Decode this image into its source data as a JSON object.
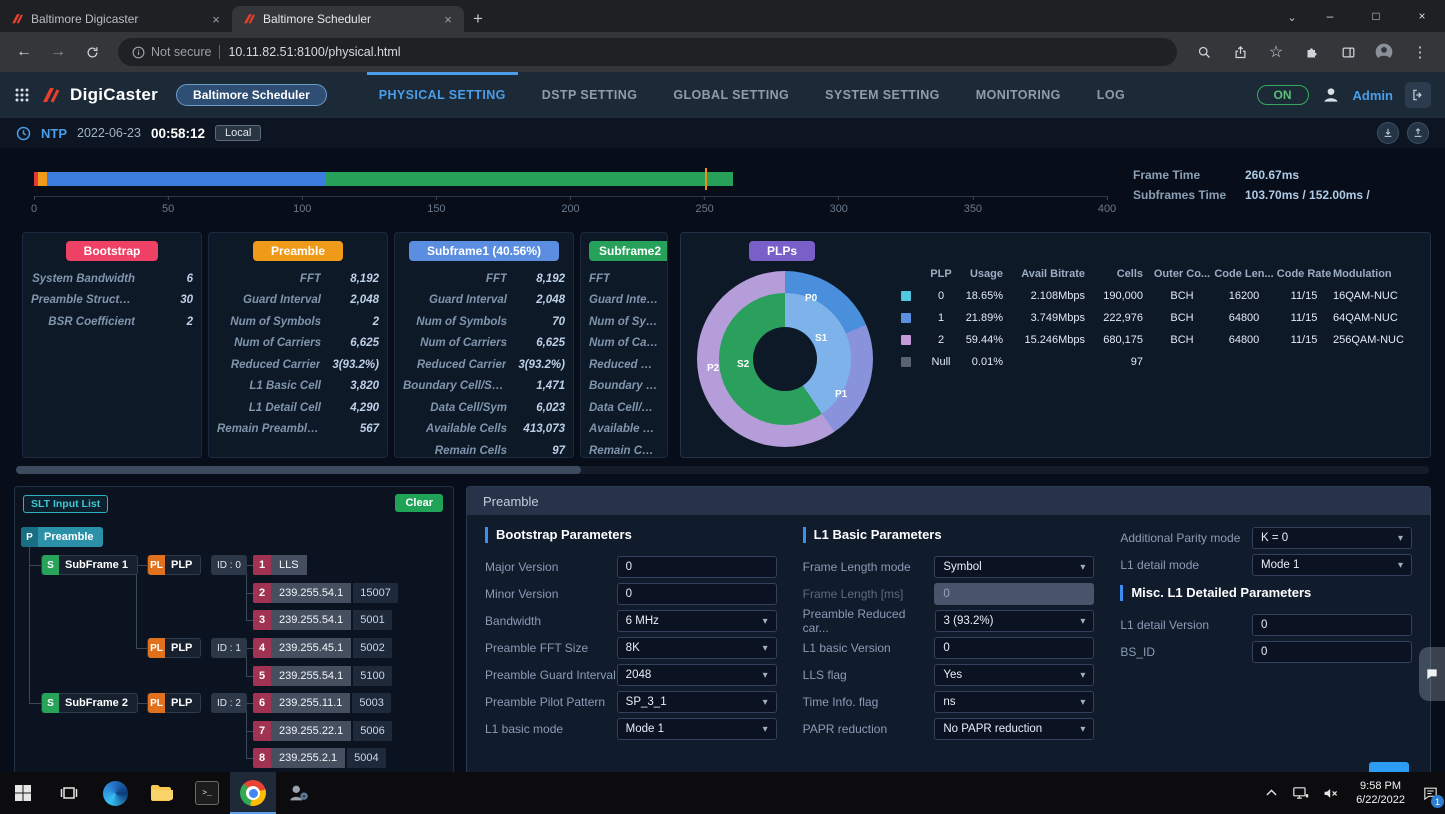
{
  "browser": {
    "tab1": "Baltimore Digicaster",
    "tab2": "Baltimore Scheduler",
    "security": "Not secure",
    "url": "10.11.82.51:8100/physical.html"
  },
  "app_header": {
    "logo_text": "DigiCaster",
    "site": "Baltimore Scheduler",
    "nav": [
      "PHYSICAL SETTING",
      "DSTP SETTING",
      "GLOBAL SETTING",
      "SYSTEM SETTING",
      "MONITORING",
      "LOG"
    ],
    "power": "ON",
    "user": "Admin",
    "accent_color": "#4a9de8"
  },
  "ntp": {
    "label": "NTP",
    "date": "2022-06-23",
    "time": "00:58:12",
    "mode": "Local"
  },
  "timeline": {
    "axis_max": 400,
    "ticks": [
      "0",
      "50",
      "100",
      "150",
      "200",
      "250",
      "300",
      "350",
      "400"
    ],
    "segments": [
      {
        "color": "#e03a3a",
        "start": 0,
        "end": 1.5
      },
      {
        "color": "#f09a1a",
        "start": 1.5,
        "end": 4.8
      },
      {
        "color": "#3d7de0",
        "start": 4.8,
        "end": 108.5
      },
      {
        "color": "#27a05a",
        "start": 108.5,
        "end": 260.67
      }
    ],
    "marker": 250,
    "frame_time_label": "Frame Time",
    "frame_time": "260.67ms",
    "subframes_label": "Subframes Time",
    "subframes": "103.70ms / 152.00ms /"
  },
  "cards": [
    {
      "title": "Bootstrap",
      "color": "#ee4165",
      "rows": [
        {
          "l": "System Bandwidth",
          "v": "6"
        },
        {
          "l": "Preamble Structure",
          "v": "30"
        },
        {
          "l": "BSR Coefficient",
          "v": "2"
        }
      ]
    },
    {
      "title": "Preamble",
      "color": "#f09a1a",
      "rows": [
        {
          "l": "FFT",
          "v": "8,192"
        },
        {
          "l": "Guard Interval",
          "v": "2,048"
        },
        {
          "l": "Num of Symbols",
          "v": "2"
        },
        {
          "l": "Num of Carriers",
          "v": "6,625"
        },
        {
          "l": "Reduced Carrier",
          "v": "3(93.2%)"
        },
        {
          "l": "L1 Basic Cell",
          "v": "3,820"
        },
        {
          "l": "L1 Detail Cell",
          "v": "4,290"
        },
        {
          "l": "Remain Preamble ...",
          "v": "567"
        }
      ]
    },
    {
      "title": "Subframe1 (40.56%)",
      "color": "#5b8de0",
      "rows": [
        {
          "l": "FFT",
          "v": "8,192"
        },
        {
          "l": "Guard Interval",
          "v": "2,048"
        },
        {
          "l": "Num of Symbols",
          "v": "70"
        },
        {
          "l": "Num of Carriers",
          "v": "6,625"
        },
        {
          "l": "Reduced Carrier",
          "v": "3(93.2%)"
        },
        {
          "l": "Boundary Cell/Sym",
          "v": "1,471"
        },
        {
          "l": "Data Cell/Sym",
          "v": "6,023"
        },
        {
          "l": "Available Cells",
          "v": "413,073"
        },
        {
          "l": "Remain Cells",
          "v": "97"
        }
      ]
    },
    {
      "title": "Subframe2",
      "color": "#27a05a",
      "rows": [
        {
          "l": "FFT",
          "v": ""
        },
        {
          "l": "Guard Interval",
          "v": ""
        },
        {
          "l": "Num of Symbols",
          "v": ""
        },
        {
          "l": "Num of Carriers",
          "v": ""
        },
        {
          "l": "Reduced Carrier",
          "v": ""
        },
        {
          "l": "Boundary Cell/Sym",
          "v": ""
        },
        {
          "l": "Data Cell/Sym",
          "v": ""
        },
        {
          "l": "Available Cells",
          "v": ""
        },
        {
          "l": "Remain Cells",
          "v": ""
        }
      ]
    }
  ],
  "plps": {
    "title": "PLPs",
    "badge_color": "#7a5fc8",
    "chart": {
      "type": "donut",
      "outer": [
        {
          "label": "P0",
          "value": 18.65,
          "color": "#4a8fdb"
        },
        {
          "label": "P1",
          "value": 21.89,
          "color": "#8893dc"
        },
        {
          "label": "P2",
          "value": 59.46,
          "color": "#b49dd8"
        }
      ],
      "inner": [
        {
          "label": "S1",
          "value": 40.56,
          "color": "#7db3ea"
        },
        {
          "label": "S2",
          "value": 59.44,
          "color": "#2aa05c"
        }
      ]
    },
    "table": {
      "headers": [
        "PLP",
        "Usage",
        "Avail Bitrate",
        "Cells",
        "Outer Co...",
        "Code Len...",
        "Code Rate",
        "Modulation"
      ],
      "rows": [
        {
          "color": "#52c8e0",
          "cells": [
            "0",
            "18.65%",
            "2.108Mbps",
            "190,000",
            "BCH",
            "16200",
            "11/15",
            "16QAM-NUC"
          ]
        },
        {
          "color": "#5b8fe0",
          "cells": [
            "1",
            "21.89%",
            "3.749Mbps",
            "222,976",
            "BCH",
            "64800",
            "11/15",
            "64QAM-NUC"
          ]
        },
        {
          "color": "#c49bd6",
          "cells": [
            "2",
            "59.44%",
            "15.246Mbps",
            "680,175",
            "BCH",
            "64800",
            "11/15",
            "256QAM-NUC"
          ]
        },
        {
          "color": "#596273",
          "cells": [
            "Null",
            "0.01%",
            "",
            "97",
            "",
            "",
            "",
            ""
          ]
        }
      ]
    }
  },
  "slt": {
    "title": "SLT Input List",
    "clear": "Clear",
    "root_icon": "P",
    "root": "Preamble",
    "sub_icon": "S",
    "subframes": [
      "SubFrame 1",
      "SubFrame 2"
    ],
    "plp_icon": "PL",
    "plp_label": "PLP",
    "plp_ids": [
      "ID : 0",
      "ID : 1",
      "ID : 2"
    ],
    "leaves": [
      {
        "n": "1",
        "addr": "LLS",
        "port": ""
      },
      {
        "n": "2",
        "addr": "239.255.54.1",
        "port": "15007"
      },
      {
        "n": "3",
        "addr": "239.255.54.1",
        "port": "5001"
      },
      {
        "n": "4",
        "addr": "239.255.45.1",
        "port": "5002"
      },
      {
        "n": "5",
        "addr": "239.255.54.1",
        "port": "5100"
      },
      {
        "n": "6",
        "addr": "239.255.11.1",
        "port": "5003"
      },
      {
        "n": "7",
        "addr": "239.255.22.1",
        "port": "5006"
      },
      {
        "n": "8",
        "addr": "239.255.2.1",
        "port": "5004"
      }
    ]
  },
  "form": {
    "panel_title": "Preamble",
    "col1": {
      "header": "Bootstrap Parameters",
      "fields": [
        {
          "label": "Major Version",
          "value": "0"
        },
        {
          "label": "Minor Version",
          "value": "0"
        },
        {
          "label": "Bandwidth",
          "value": "6 MHz"
        },
        {
          "label": "Preamble FFT Size",
          "value": "8K"
        },
        {
          "label": "Preamble Guard Interval",
          "value": "2048"
        },
        {
          "label": "Preamble Pilot Pattern",
          "value": "SP_3_1"
        },
        {
          "label": "L1 basic mode",
          "value": "Mode 1"
        }
      ]
    },
    "col2": {
      "header": "L1 Basic Parameters",
      "fields": [
        {
          "label": "Frame Length mode",
          "value": "Symbol"
        },
        {
          "label": "Frame Length [ms]",
          "value": "0"
        },
        {
          "label": "Preamble Reduced car...",
          "value": "3  (93.2%)"
        },
        {
          "label": "L1 basic Version",
          "value": "0"
        },
        {
          "label": "LLS flag",
          "value": "Yes"
        },
        {
          "label": "Time Info. flag",
          "value": "ns"
        },
        {
          "label": "PAPR reduction",
          "value": "No PAPR reduction"
        }
      ]
    },
    "col3": {
      "fields_top": [
        {
          "label": "Additional Parity mode",
          "value": "K = 0"
        },
        {
          "label": "L1 detail mode",
          "value": "Mode 1"
        }
      ],
      "header": "Misc. L1 Detailed Parameters",
      "fields_bottom": [
        {
          "label": "L1 detail Version",
          "value": "0"
        },
        {
          "label": "BS_ID",
          "value": "0"
        }
      ]
    }
  },
  "taskbar": {
    "time": "9:58 PM",
    "date": "6/22/2022",
    "badge": "1"
  }
}
